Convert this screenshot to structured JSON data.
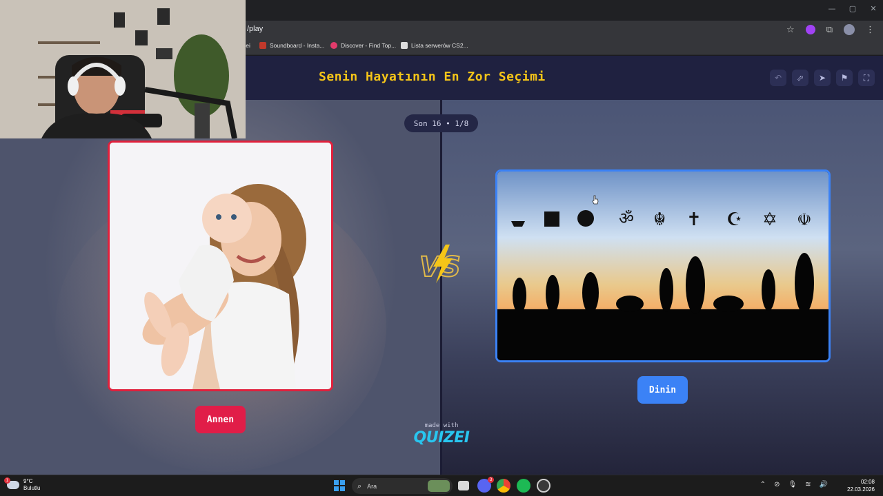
{
  "browser": {
    "url": "/play",
    "bookmarks": [
      {
        "label": "zei",
        "color": "#555"
      },
      {
        "label": "Soundboard - Insta...",
        "color": "#c0392b"
      },
      {
        "label": "Discover - Find Top...",
        "color": "#e23b6b"
      },
      {
        "label": "Lista serwerów CS2...",
        "color": "#dddddd"
      }
    ],
    "window_controls": [
      "—",
      "▢",
      "✕"
    ]
  },
  "page": {
    "title": "Senin Hayatının En Zor Seçimi",
    "counter": "Son 16 • 1/8",
    "toolbar": [
      "undo-icon",
      "share-icon",
      "send-icon",
      "flag-icon",
      "fullscreen-icon"
    ],
    "left_choice": {
      "label": "Annen",
      "image": "mother-holding-baby",
      "accent": "#e11d48"
    },
    "right_choice": {
      "label": "Dinin",
      "image": "religions-silhouette",
      "accent": "#3b82f6"
    },
    "vs_label": "VS",
    "footer_made_with": "made with",
    "footer_brand": "QUIZEI"
  },
  "taskbar": {
    "weather_temp": "9°C",
    "weather_desc": "Bulutlu",
    "weather_badge": "1",
    "search_placeholder": "Ara",
    "discord_badge": "3",
    "time": "02:08",
    "date": "22.03.2026"
  }
}
